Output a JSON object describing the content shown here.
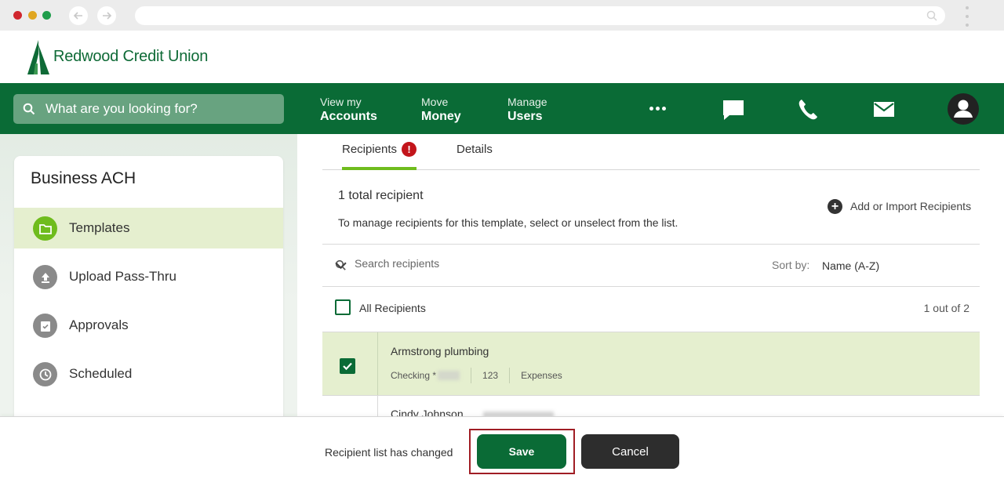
{
  "brand": {
    "name": "Redwood Credit Union",
    "green": "#0a6b36",
    "accent": "#6fbc1d"
  },
  "topnav": {
    "search_placeholder": "What are you looking for?",
    "items": [
      {
        "small": "View my",
        "big": "Accounts"
      },
      {
        "small": "Move",
        "big": "Money"
      },
      {
        "small": "Manage",
        "big": "Users"
      }
    ],
    "icons": [
      "more-icon",
      "chat-icon",
      "phone-icon",
      "mail-icon",
      "profile-icon"
    ]
  },
  "sidebar": {
    "title": "Business ACH",
    "items": [
      {
        "label": "Templates",
        "icon": "folder-icon",
        "active": true
      },
      {
        "label": "Upload Pass-Thru",
        "icon": "upload-icon",
        "active": false
      },
      {
        "label": "Approvals",
        "icon": "clipboard-check-icon",
        "active": false
      },
      {
        "label": "Scheduled",
        "icon": "clock-icon",
        "active": false
      }
    ]
  },
  "tabs": [
    {
      "label": "Recipients",
      "badge": "!"
    },
    {
      "label": "Details"
    }
  ],
  "recipients": {
    "total": "1 total recipient",
    "instructions": "To manage recipients for this template, select or unselect from the list.",
    "add_link": "Add or Import Recipients",
    "search_placeholder": "Search recipients",
    "sort_label": "Sort by:",
    "sort_value": "Name (A-Z)",
    "all_label": "All Recipients",
    "count": "1 out of 2",
    "list": [
      {
        "name": "Armstrong plumbing",
        "account": "Checking *",
        "code": "123",
        "category": "Expenses",
        "checked": true
      },
      {
        "name": "Cindy Johnson",
        "checked": false
      }
    ]
  },
  "footer": {
    "message": "Recipient list has changed",
    "save_label": "Save",
    "cancel_label": "Cancel"
  }
}
